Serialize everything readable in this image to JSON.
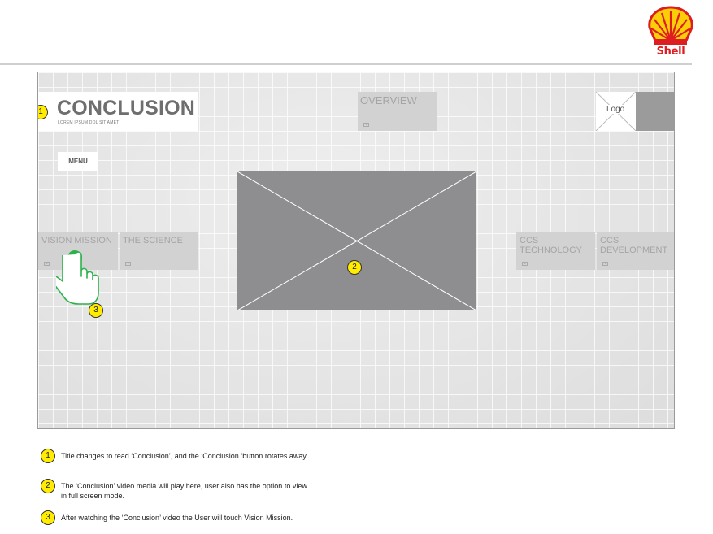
{
  "brand": {
    "name": "Shell",
    "colors": {
      "red": "#dd1d21",
      "yellow": "#fbce07"
    }
  },
  "screen": {
    "title": "CONCLUSION",
    "subtitle": "LOREM IPSUM DOL SIT AMET",
    "menu_label": "MENU",
    "logo_label": "Logo",
    "tiles": {
      "overview": "OVERVIEW",
      "vision_mission": "VISION MISSION",
      "the_science": "THE SCIENCE",
      "ccs_technology": "CCS\nTECHNOLOGY",
      "ccs_development": "CCS\nDEVELOPMENT"
    },
    "video_icon": "video-placeholder-icon"
  },
  "callouts": [
    "1",
    "2",
    "3"
  ],
  "notes": [
    {
      "number": "1",
      "text": "Title changes to read ‘Conclusion’, and the ‘Conclusion ‘button rotates away."
    },
    {
      "number": "2",
      "text": "The ‘Conclusion’ video media will play here, user also has the option to view\nin full screen mode."
    },
    {
      "number": "3",
      "text": "After watching the ‘Conclusion’ video the User will touch Vision Mission."
    }
  ],
  "colors": {
    "callout_fill": "#ffec00",
    "touch_indicator": "#2db24a",
    "tile_bg": "#d2d2d2",
    "video_bg": "#8e8e90"
  }
}
